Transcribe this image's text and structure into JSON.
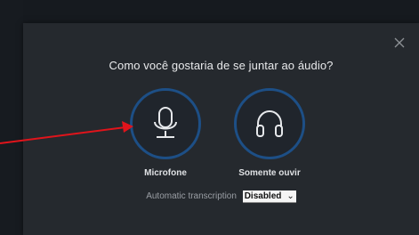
{
  "modal": {
    "title": "Como você gostaria de se juntar ao áudio?",
    "close_icon": "close-icon"
  },
  "options": {
    "microphone": {
      "label": "Microfone",
      "icon": "microphone-icon"
    },
    "listen_only": {
      "label": "Somente ouvir",
      "icon": "headphones-icon"
    }
  },
  "transcription": {
    "label": "Automatic transcription",
    "selected": "Disabled",
    "chevron": "⌄"
  },
  "colors": {
    "accent_ring": "#1d4f86",
    "annotation_arrow": "#e0141b"
  }
}
